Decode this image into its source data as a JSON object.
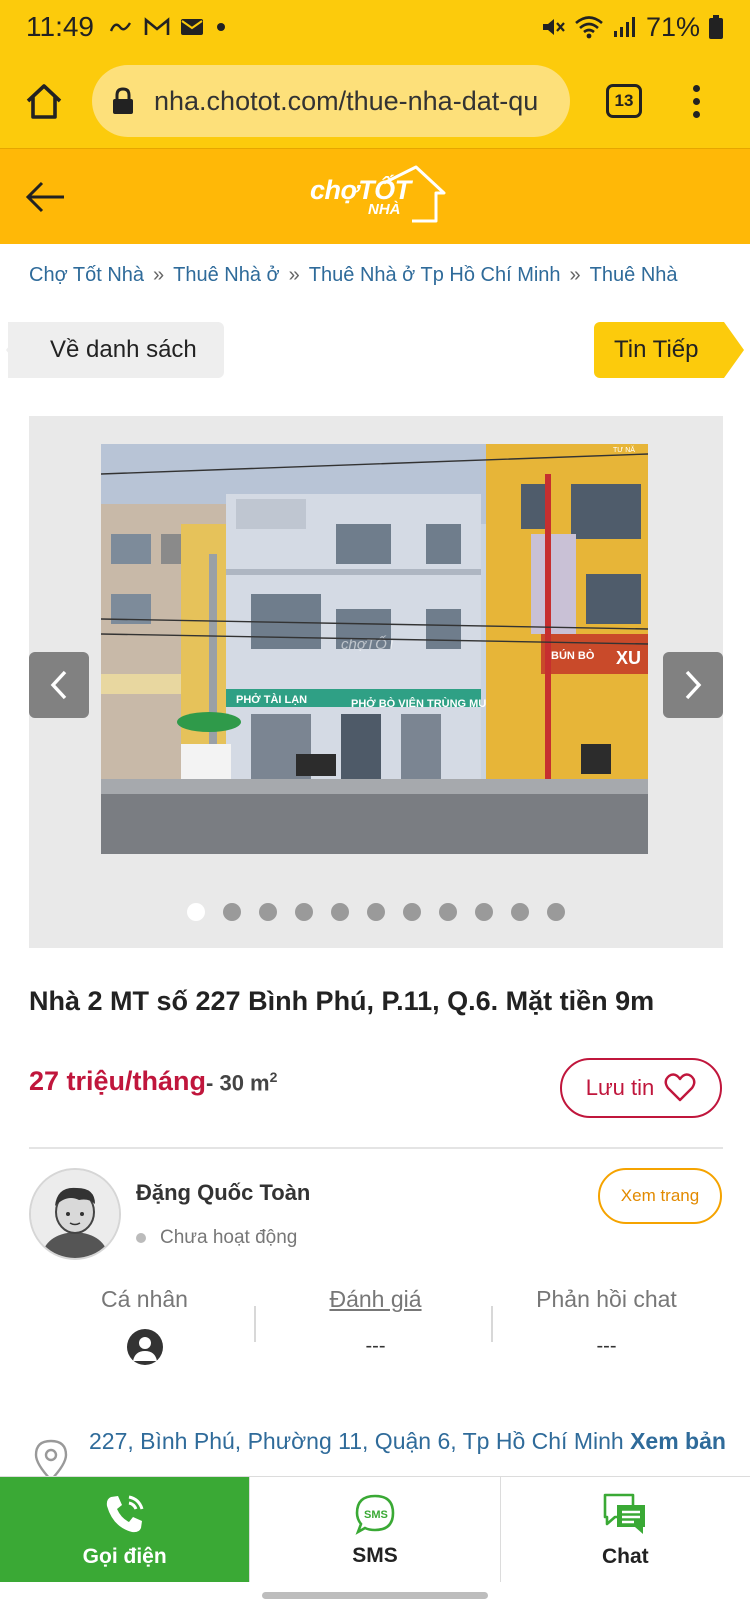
{
  "status_bar": {
    "time": "11:49",
    "battery": "71%",
    "icons": [
      "link-icon",
      "gmail-icon",
      "mail-icon",
      "dot-icon",
      "mute-icon",
      "wifi-icon",
      "signal-icon",
      "battery-icon"
    ]
  },
  "browser": {
    "url": "nha.chotot.com/thue-nha-dat-qu",
    "tab_count": "13"
  },
  "header": {
    "logo_text_cho": "chợTỐT",
    "logo_text_nha": "NHÀ",
    "brand_color": "#ffb807"
  },
  "breadcrumb": [
    "Chợ Tốt Nhà",
    "Thuê Nhà ở",
    "Thuê Nhà ở Tp Hồ Chí Minh",
    "Thuê Nhà"
  ],
  "breadcrumb_separator": "»",
  "nav": {
    "back_label": "Về danh sách",
    "next_label": "Tin Tiếp"
  },
  "gallery": {
    "image_count": 11,
    "active_index": 0,
    "watermark": "chợTỐT",
    "signs": [
      "PHỞ TÀI LẠN",
      "PHỞ BÒ VIÊN TRÙNG MUỘI",
      "BÚN BÒ",
      "XU",
      "TƯ NĂ"
    ]
  },
  "listing": {
    "title": "Nhà 2 MT số 227 Bình Phú, P.11, Q.6. Mặt tiền 9m",
    "price": "27 triệu/tháng",
    "area_prefix": "- 30 m",
    "area_sup": "2",
    "save_label": "Lưu tin",
    "price_color": "#c0163c"
  },
  "seller": {
    "name": "Đặng Quốc Toàn",
    "status": "Chưa hoạt động",
    "view_page_label": "Xem trang",
    "stats": [
      {
        "label": "Cá nhân",
        "value": ""
      },
      {
        "label": "Đánh giá",
        "value": "---"
      },
      {
        "label": "Phản hồi chat",
        "value": "---"
      }
    ]
  },
  "address": {
    "text": "227, Bình Phú, Phường 11, Quận 6, Tp Hồ Chí Minh",
    "map_link": "Xem bản đồ »"
  },
  "bottom_bar": {
    "call_label": "Gọi điện",
    "sms_label": "SMS",
    "sms_icon_text": "SMS",
    "chat_label": "Chat",
    "call_color": "#3aa935"
  }
}
